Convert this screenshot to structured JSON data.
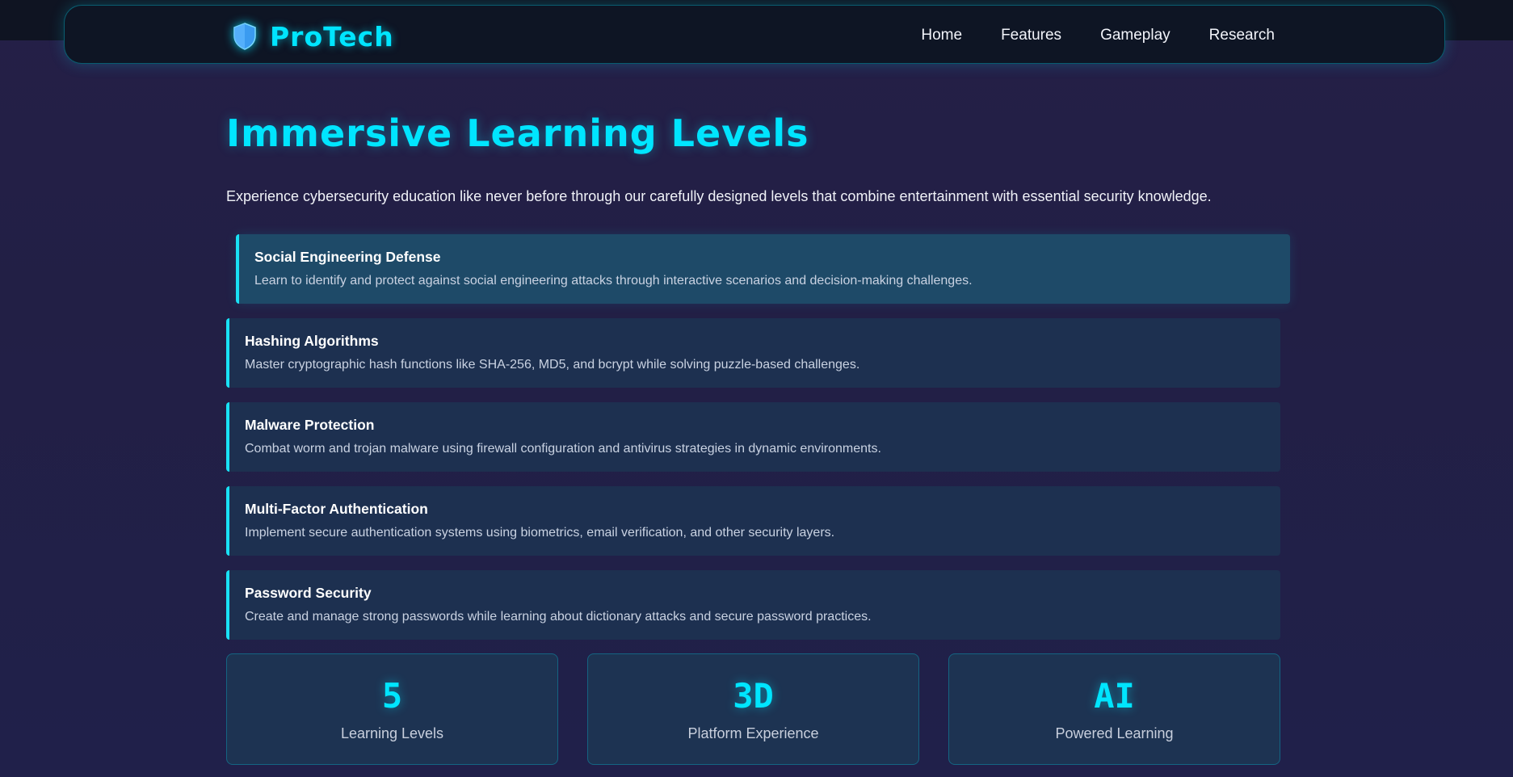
{
  "brand": {
    "name": "ProTech",
    "icon": "shield-icon"
  },
  "nav": {
    "links": [
      {
        "label": "Home"
      },
      {
        "label": "Features"
      },
      {
        "label": "Gameplay"
      },
      {
        "label": "Research"
      }
    ]
  },
  "main": {
    "title": "Immersive Learning Levels",
    "intro": "Experience cybersecurity education like never before through our carefully designed levels that combine entertainment with essential security knowledge."
  },
  "levels": [
    {
      "title": "Social Engineering Defense",
      "description": "Learn to identify and protect against social engineering attacks through interactive scenarios and decision-making challenges."
    },
    {
      "title": "Hashing Algorithms",
      "description": "Master cryptographic hash functions like SHA-256, MD5, and bcrypt while solving puzzle-based challenges."
    },
    {
      "title": "Malware Protection",
      "description": "Combat worm and trojan malware using firewall configuration and antivirus strategies in dynamic environments."
    },
    {
      "title": "Multi-Factor Authentication",
      "description": "Implement secure authentication systems using biometrics, email verification, and other security layers."
    },
    {
      "title": "Password Security",
      "description": "Create and manage strong passwords while learning about dictionary attacks and secure password practices."
    }
  ],
  "stats": [
    {
      "value": "5",
      "label": "Learning Levels"
    },
    {
      "value": "3D",
      "label": "Platform Experience"
    },
    {
      "value": "AI",
      "label": "Powered Learning"
    }
  ],
  "colors": {
    "accent": "#00e5ff",
    "background": "#221f45",
    "card": "#1d3050",
    "card_active": "#1e4a68"
  }
}
